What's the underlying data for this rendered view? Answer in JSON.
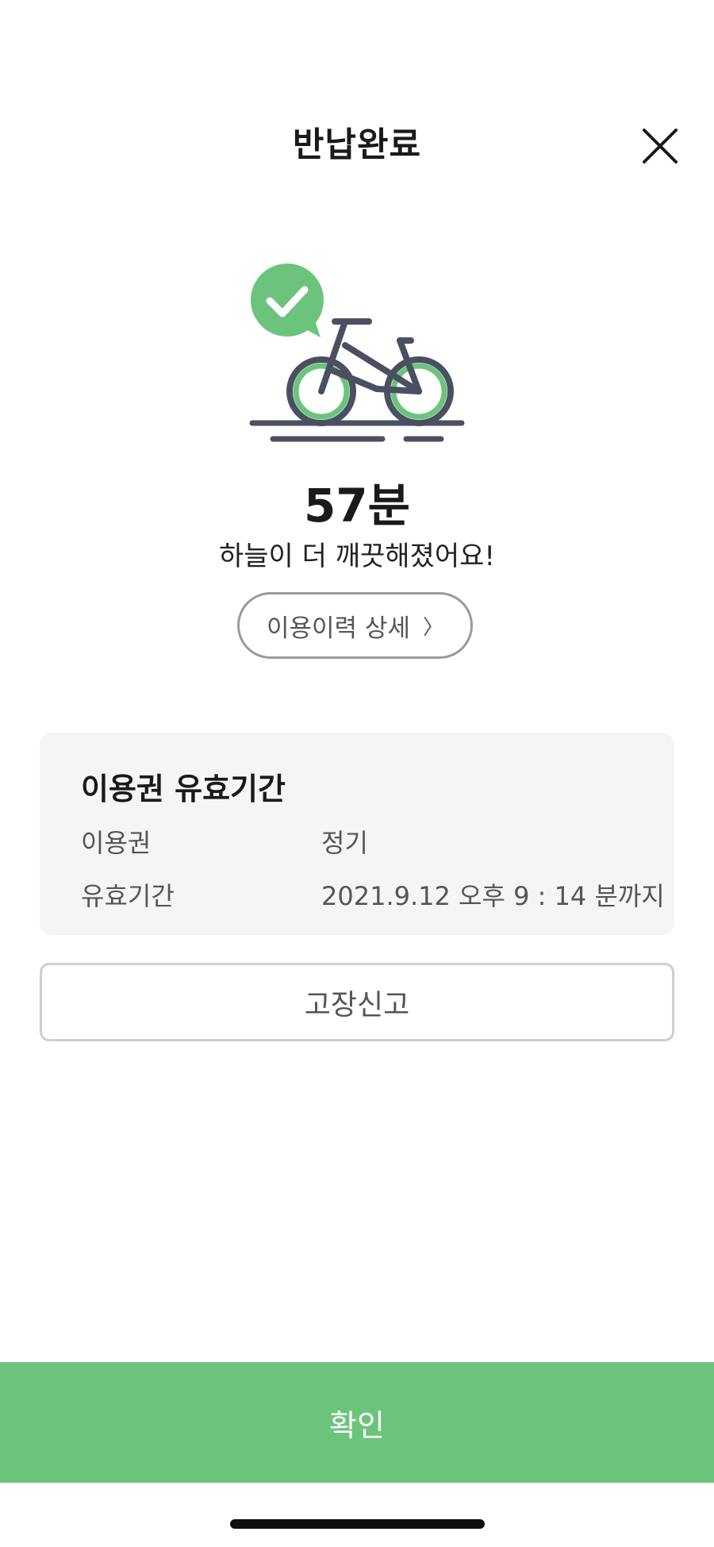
{
  "header": {
    "title": "반납완료",
    "close_icon": "close-icon"
  },
  "illustration": {
    "icon": "bicycle-check-icon",
    "accent_color": "#6cc47c",
    "line_color": "#4a5060"
  },
  "result": {
    "duration": "57분",
    "message": "하늘이 더 깨끗해졌어요!"
  },
  "history_button": {
    "label": "이용이력 상세",
    "icon": "chevron-right-icon",
    "glyph": "〉"
  },
  "ticket_card": {
    "title": "이용권 유효기간",
    "rows": [
      {
        "label": "이용권",
        "value": "정기"
      },
      {
        "label": "유효기간",
        "value": "2021.9.12 오후 9 : 14 분까지"
      }
    ]
  },
  "report_button": {
    "label": "고장신고"
  },
  "confirm_button": {
    "label": "확인",
    "color": "#6cc47c"
  }
}
